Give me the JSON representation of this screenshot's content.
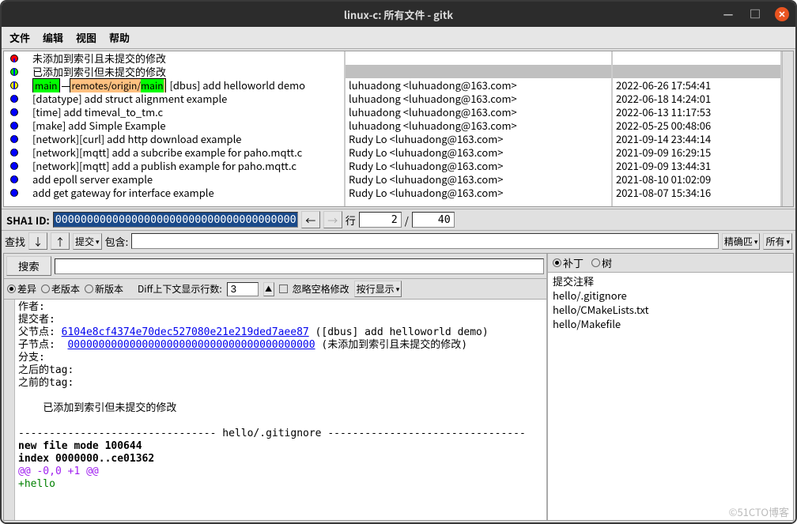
{
  "title": "linux-c: 所有文件 - gitk",
  "menu": {
    "file": "文件",
    "edit": "编辑",
    "view": "视图",
    "help": "帮助"
  },
  "commits": [
    {
      "graph": "red-dot",
      "msg": "未添加到索引且未提交的修改",
      "author": "",
      "date": ""
    },
    {
      "graph": "green-dot-sel",
      "msg": "已添加到索引但未提交的修改",
      "author": "",
      "date": "",
      "selected": true
    },
    {
      "graph": "yellow-branch",
      "msg": "[dbus] add helloworld demo",
      "author": "luhuadong <luhuadong@163.com>",
      "date": "2022-06-26 17:54:41",
      "branchMain": "main",
      "branchRemote": "remotes/origin/",
      "branchRemoteMain": "main"
    },
    {
      "graph": "blue",
      "msg": "[datatype] add struct alignment example",
      "author": "luhuadong <luhuadong@163.com>",
      "date": "2022-06-18 14:24:01"
    },
    {
      "graph": "blue",
      "msg": "[time] add timeval_to_tm.c",
      "author": "luhuadong <luhuadong@163.com>",
      "date": "2022-06-13 11:17:53"
    },
    {
      "graph": "blue",
      "msg": "[make] add Simple Example",
      "author": "luhuadong <luhuadong@163.com>",
      "date": "2022-05-25 00:48:06"
    },
    {
      "graph": "blue",
      "msg": "[network][curl] add http download example",
      "author": "Rudy Lo <luhuadong@163.com>",
      "date": "2021-09-14 23:44:14"
    },
    {
      "graph": "blue",
      "msg": "[network][mqtt] add a subcribe example for paho.mqtt.c",
      "author": "Rudy Lo <luhuadong@163.com>",
      "date": "2021-09-09 16:29:15"
    },
    {
      "graph": "blue",
      "msg": "[network][mqtt] add a publish example for paho.mqtt.c",
      "author": "Rudy Lo <luhuadong@163.com>",
      "date": "2021-09-09 13:44:31"
    },
    {
      "graph": "blue",
      "msg": "add epoll server example",
      "author": "Rudy Lo <luhuadong@163.com>",
      "date": "2021-08-10 01:02:09"
    },
    {
      "graph": "blue",
      "msg": "add get gateway for interface example",
      "author": "Rudy Lo <luhuadong@163.com>",
      "date": "2021-08-07 15:34:16"
    }
  ],
  "sha": {
    "label": "SHA1 ID:",
    "value": "0000000000000000000000000000000000000001",
    "row_label": "行",
    "current": "2",
    "sep": "/",
    "total": "40"
  },
  "find": {
    "label": "查找",
    "commit": "提交",
    "contains": "包含:",
    "exact": "精确匹",
    "allfields": "所有"
  },
  "search": {
    "btn": "搜索"
  },
  "diffopts": {
    "diff": "差异",
    "old": "老版本",
    "new": "新版本",
    "ctx_label": "Diff上下文显示行数:",
    "ctx_val": "3",
    "ignore_ws": "忽略空格修改",
    "line_disp": "按行显示"
  },
  "detail": {
    "author": "作者:",
    "committer": "提交者:",
    "parent_label": "父节点:",
    "parent_sha": "6104e8cf4374e70dec527080e21e219ded7aee87",
    "parent_msg": " ([dbus] add helloworld demo)",
    "child_label": "子节点:",
    "child_sha": "0000000000000000000000000000000000000000",
    "child_msg": " (未添加到索引且未提交的修改)",
    "branch": "分支:",
    "after_tag": "之后的tag:",
    "before_tag": "之前的tag:",
    "subject": "已添加到索引但未提交的修改",
    "sep": "-------------------------------- hello/.gitignore --------------------------------",
    "mode": "new file mode 100644",
    "index": "index 0000000..ce01362",
    "hunk": "@@ -0,0 +1 @@",
    "add": "+hello"
  },
  "tree": {
    "patch": "补丁",
    "tree": "树",
    "note": "提交注释",
    "files": [
      "hello/.gitignore",
      "hello/CMakeLists.txt",
      "hello/Makefile"
    ]
  },
  "watermark": "©51CTO博客"
}
